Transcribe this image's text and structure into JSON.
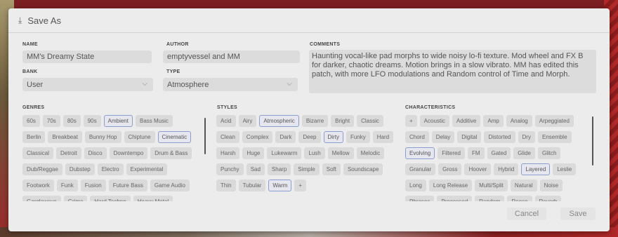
{
  "dialog": {
    "title": "Save As",
    "icon": "download-icon"
  },
  "name": {
    "label": "NAME",
    "value": "MM's Dreamy State"
  },
  "author": {
    "label": "AUTHOR",
    "value": "emptyvessel and MM"
  },
  "comments": {
    "label": "COMMENTS",
    "value": "Haunting vocal-like pad morphs to wide noisy lo-fi texture. Mod wheel and FX B for darker, chaotic dreams. Motion brings in a slow vibrato. MM has edited this patch, with more LFO modulations and Random control of Time and Morph."
  },
  "bank": {
    "label": "BANK",
    "value": "User"
  },
  "type": {
    "label": "TYPE",
    "value": "Atmosphere"
  },
  "genres": {
    "label": "GENRES",
    "tags": [
      {
        "label": "60s",
        "selected": false
      },
      {
        "label": "70s",
        "selected": false
      },
      {
        "label": "80s",
        "selected": false
      },
      {
        "label": "90s",
        "selected": false
      },
      {
        "label": "Ambient",
        "selected": true
      },
      {
        "label": "Bass Music",
        "selected": false
      },
      {
        "label": "Berlin",
        "selected": false
      },
      {
        "label": "Breakbeat",
        "selected": false
      },
      {
        "label": "Bunny Hop",
        "selected": false
      },
      {
        "label": "Chiptune",
        "selected": false
      },
      {
        "label": "Cinematic",
        "selected": true
      },
      {
        "label": "Classical",
        "selected": false
      },
      {
        "label": "Detroit",
        "selected": false
      },
      {
        "label": "Disco",
        "selected": false
      },
      {
        "label": "Downtempo",
        "selected": false
      },
      {
        "label": "Drum & Bass",
        "selected": false
      },
      {
        "label": "Dub/Reggae",
        "selected": false
      },
      {
        "label": "Dubstep",
        "selected": false
      },
      {
        "label": "Electro",
        "selected": false
      },
      {
        "label": "Experimental",
        "selected": false
      },
      {
        "label": "Footwork",
        "selected": false
      },
      {
        "label": "Funk",
        "selected": false
      },
      {
        "label": "Fusion",
        "selected": false
      },
      {
        "label": "Future Bass",
        "selected": false
      },
      {
        "label": "Game Audio",
        "selected": false
      },
      {
        "label": "Garglewave",
        "selected": false
      },
      {
        "label": "Grime",
        "selected": false
      },
      {
        "label": "Hard Techno",
        "selected": false
      },
      {
        "label": "Heavy Metal",
        "selected": false
      }
    ]
  },
  "styles": {
    "label": "STYLES",
    "tags": [
      {
        "label": "Acid",
        "selected": false
      },
      {
        "label": "Airy",
        "selected": false
      },
      {
        "label": "Atmospheric",
        "selected": true
      },
      {
        "label": "Bizarre",
        "selected": false
      },
      {
        "label": "Bright",
        "selected": false
      },
      {
        "label": "Classic",
        "selected": false
      },
      {
        "label": "Clean",
        "selected": false
      },
      {
        "label": "Complex",
        "selected": false
      },
      {
        "label": "Dark",
        "selected": false
      },
      {
        "label": "Deep",
        "selected": false
      },
      {
        "label": "Dirty",
        "selected": true
      },
      {
        "label": "Funky",
        "selected": false
      },
      {
        "label": "Hard",
        "selected": false
      },
      {
        "label": "Harsh",
        "selected": false
      },
      {
        "label": "Huge",
        "selected": false
      },
      {
        "label": "Lukewarm",
        "selected": false
      },
      {
        "label": "Lush",
        "selected": false
      },
      {
        "label": "Mellow",
        "selected": false
      },
      {
        "label": "Melodic",
        "selected": false
      },
      {
        "label": "Punchy",
        "selected": false
      },
      {
        "label": "Sad",
        "selected": false
      },
      {
        "label": "Sharp",
        "selected": false
      },
      {
        "label": "Simple",
        "selected": false
      },
      {
        "label": "Soft",
        "selected": false
      },
      {
        "label": "Soundscape",
        "selected": false
      },
      {
        "label": "Thin",
        "selected": false
      },
      {
        "label": "Tubular",
        "selected": false
      },
      {
        "label": "Warm",
        "selected": true
      },
      {
        "label": "+",
        "selected": false
      }
    ]
  },
  "characteristics": {
    "label": "CHARACTERISTICS",
    "tags": [
      {
        "label": "+",
        "selected": false
      },
      {
        "label": "Acoustic",
        "selected": false
      },
      {
        "label": "Additive",
        "selected": false
      },
      {
        "label": "Amp",
        "selected": false
      },
      {
        "label": "Analog",
        "selected": false
      },
      {
        "label": "Arpeggiated",
        "selected": false
      },
      {
        "label": "Chord",
        "selected": false
      },
      {
        "label": "Delay",
        "selected": false
      },
      {
        "label": "Digital",
        "selected": false
      },
      {
        "label": "Distorted",
        "selected": false
      },
      {
        "label": "Dry",
        "selected": false
      },
      {
        "label": "Ensemble",
        "selected": false
      },
      {
        "label": "Evolving",
        "selected": true
      },
      {
        "label": "Filtered",
        "selected": false
      },
      {
        "label": "FM",
        "selected": false
      },
      {
        "label": "Gated",
        "selected": false
      },
      {
        "label": "Glide",
        "selected": false
      },
      {
        "label": "Glitch",
        "selected": false
      },
      {
        "label": "Granular",
        "selected": false
      },
      {
        "label": "Gross",
        "selected": false
      },
      {
        "label": "Hoover",
        "selected": false
      },
      {
        "label": "Hybrid",
        "selected": false
      },
      {
        "label": "Layered",
        "selected": true
      },
      {
        "label": "Leslie",
        "selected": false
      },
      {
        "label": "Long",
        "selected": false
      },
      {
        "label": "Long Release",
        "selected": false
      },
      {
        "label": "Multi/Split",
        "selected": false
      },
      {
        "label": "Natural",
        "selected": false
      },
      {
        "label": "Noise",
        "selected": false
      },
      {
        "label": "Phrases",
        "selected": false
      },
      {
        "label": "Processed",
        "selected": false
      },
      {
        "label": "Random",
        "selected": false
      },
      {
        "label": "Reese",
        "selected": false
      },
      {
        "label": "Reverb",
        "selected": false
      }
    ]
  },
  "buttons": {
    "cancel": "Cancel",
    "save": "Save"
  }
}
